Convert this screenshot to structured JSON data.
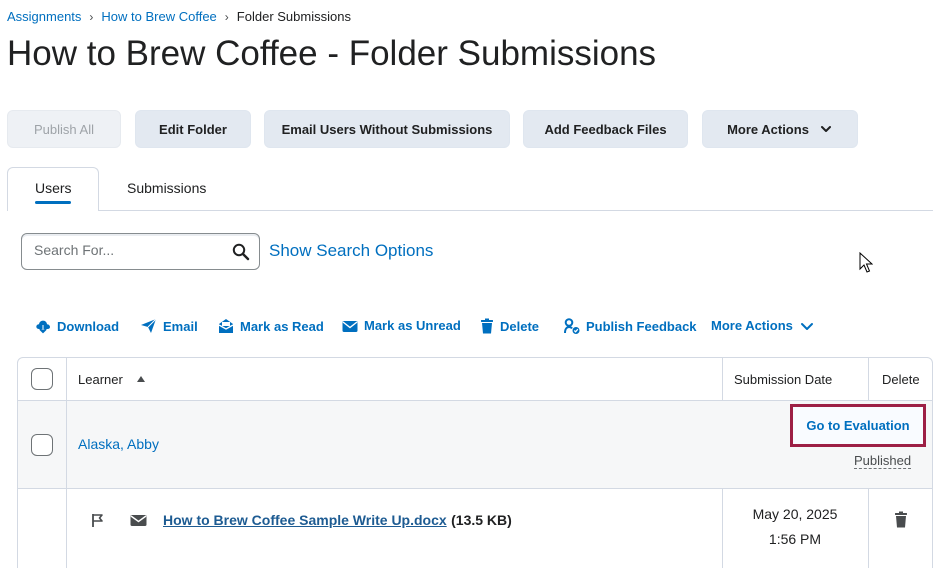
{
  "breadcrumb": {
    "items": [
      "Assignments",
      "How to Brew Coffee"
    ],
    "current": "Folder Submissions"
  },
  "page": {
    "title": "How to Brew Coffee - Folder Submissions"
  },
  "toolbar": {
    "publish_all": "Publish All",
    "edit_folder": "Edit Folder",
    "email_users": "Email Users Without Submissions",
    "add_feedback": "Add Feedback Files",
    "more_actions": "More Actions"
  },
  "tabs": [
    {
      "label": "Users",
      "active": true
    },
    {
      "label": "Submissions",
      "active": false
    }
  ],
  "search": {
    "placeholder": "Search For...",
    "value": "",
    "show_options": "Show Search Options"
  },
  "actions": {
    "download": "Download",
    "email": "Email",
    "mark_read": "Mark as Read",
    "mark_unread": "Mark as Unread",
    "delete": "Delete",
    "publish_feedback": "Publish Feedback",
    "more_actions": "More Actions"
  },
  "table": {
    "headers": {
      "learner": "Learner",
      "submission_date": "Submission Date",
      "delete": "Delete"
    },
    "learner_row": {
      "name": "Alaska, Abby",
      "go_to_evaluation": "Go to Evaluation",
      "status": "Published"
    },
    "submission_row": {
      "file_name": "How to Brew Coffee Sample Write Up.docx",
      "file_size": "(13.5 KB)",
      "date": "May 20, 2025",
      "time": "1:56 PM"
    }
  },
  "colors": {
    "link": "#006fbf",
    "highlight_border": "#9d1f45",
    "button_bg": "#e3e9f1"
  }
}
